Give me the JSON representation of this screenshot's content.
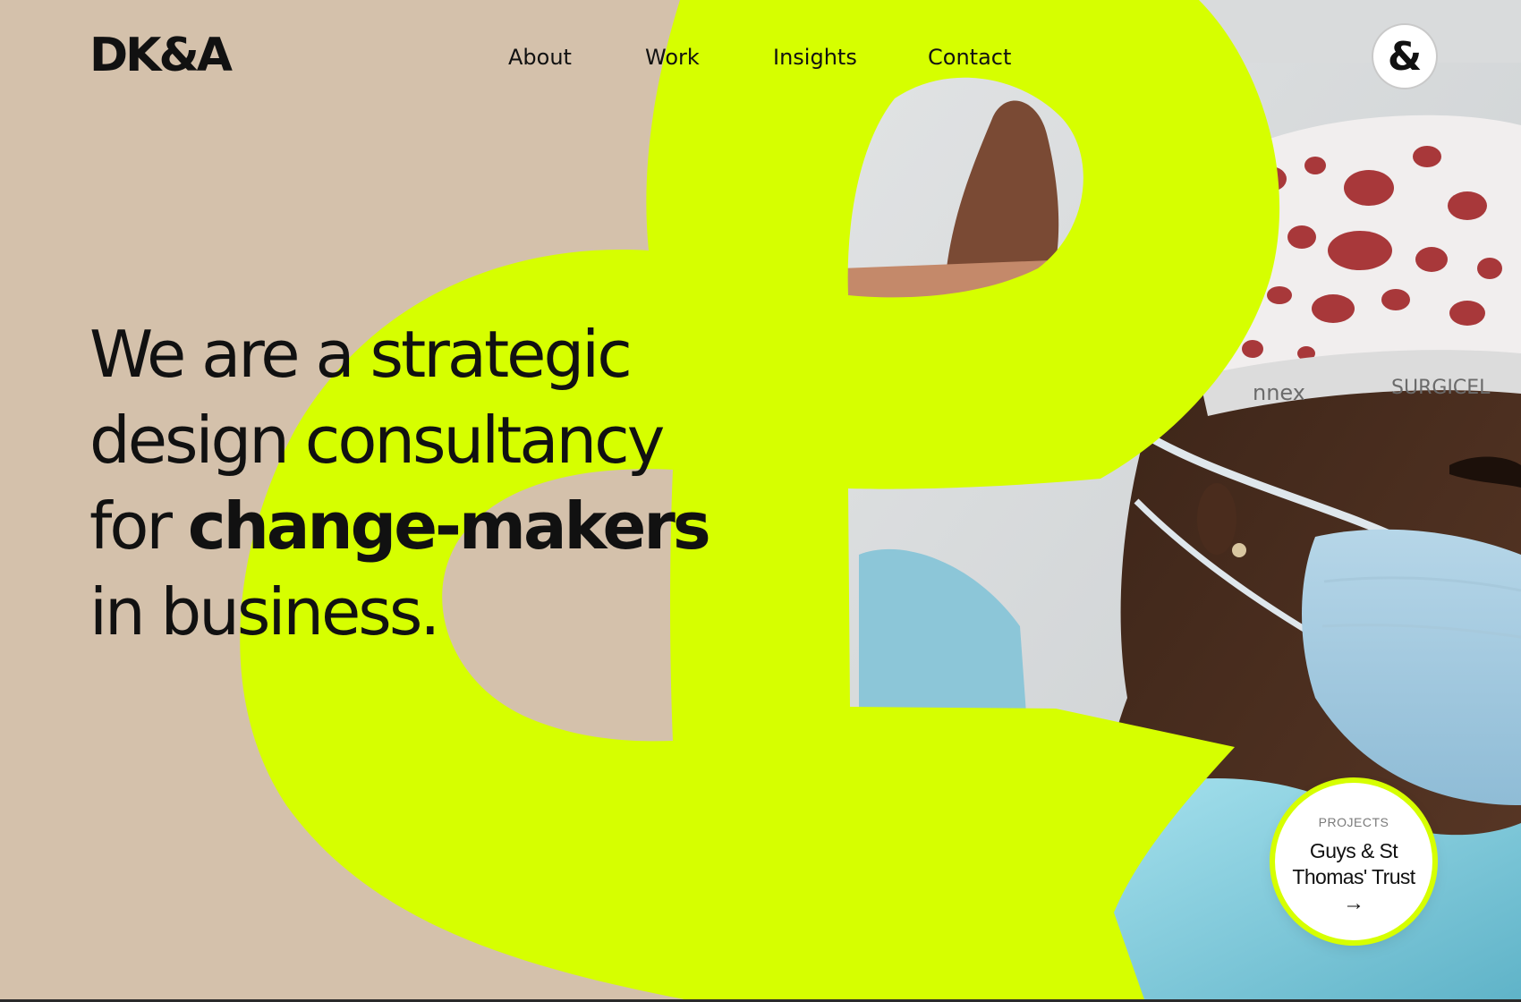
{
  "brand": {
    "logo_text": "DK&A"
  },
  "nav": {
    "items": [
      {
        "label": "About"
      },
      {
        "label": "Work"
      },
      {
        "label": "Insights"
      },
      {
        "label": "Contact"
      }
    ],
    "badge_symbol": "&"
  },
  "hero": {
    "line1": "We are a strategic",
    "line2": "design consultancy",
    "line3_prefix": "for ",
    "line3_bold": "change-makers",
    "line4": "in business."
  },
  "project_card": {
    "eyebrow": "PROJECTS",
    "name_line1": "Guys & St",
    "name_line2": "Thomas' Trust",
    "arrow_symbol": "→"
  },
  "photo": {
    "cap_text_1": "nnex",
    "cap_text_2": "SURGICEL"
  },
  "colors": {
    "background": "#d4c1ab",
    "accent": "#d6ff00",
    "text": "#111111"
  }
}
